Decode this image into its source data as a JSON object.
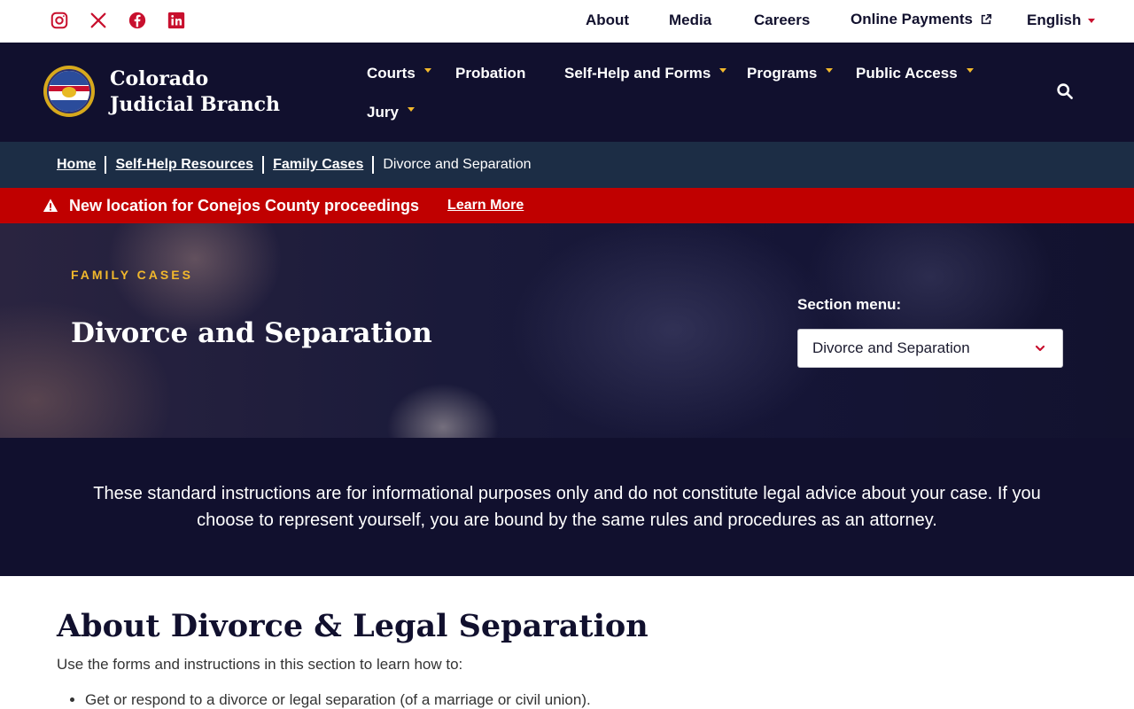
{
  "utility": {
    "social": [
      "instagram-icon",
      "x-icon",
      "facebook-icon",
      "linkedin-icon"
    ],
    "links": {
      "about": "About",
      "media": "Media",
      "careers": "Careers",
      "online_payments": "Online Payments",
      "language": "English"
    }
  },
  "header": {
    "brand": "Colorado Judicial Branch",
    "nav": {
      "courts": "Courts",
      "probation": "Probation",
      "self_help": "Self-Help and Forms",
      "programs": "Programs",
      "public_access": "Public Access",
      "jury": "Jury"
    }
  },
  "breadcrumb": {
    "home": "Home",
    "self_help": "Self-Help Resources",
    "family": "Family Cases",
    "current": "Divorce and Separation"
  },
  "alert": {
    "text": "New location for Conejos County proceedings",
    "link": "Learn More"
  },
  "hero": {
    "eyebrow": "FAMILY CASES",
    "title": "Divorce and Separation",
    "section_label": "Section menu:",
    "section_selected": "Divorce and Separation"
  },
  "disclaimer": {
    "text": "These standard instructions are for informational purposes only and do not constitute legal advice about your case. If you choose to represent yourself, you are bound by the same rules and procedures as an attorney."
  },
  "content": {
    "heading": "About Divorce & Legal Separation",
    "intro": "Use the forms and instructions in this section to learn how to:",
    "items": [
      "Get or respond to a divorce or legal separation (of a marriage or civil union)."
    ]
  },
  "colors": {
    "navy": "#11102e",
    "crumb_bar": "#1c2d45",
    "alert_red": "#c00000",
    "accent_gold": "#f2b82c",
    "social_red": "#c8102e"
  }
}
